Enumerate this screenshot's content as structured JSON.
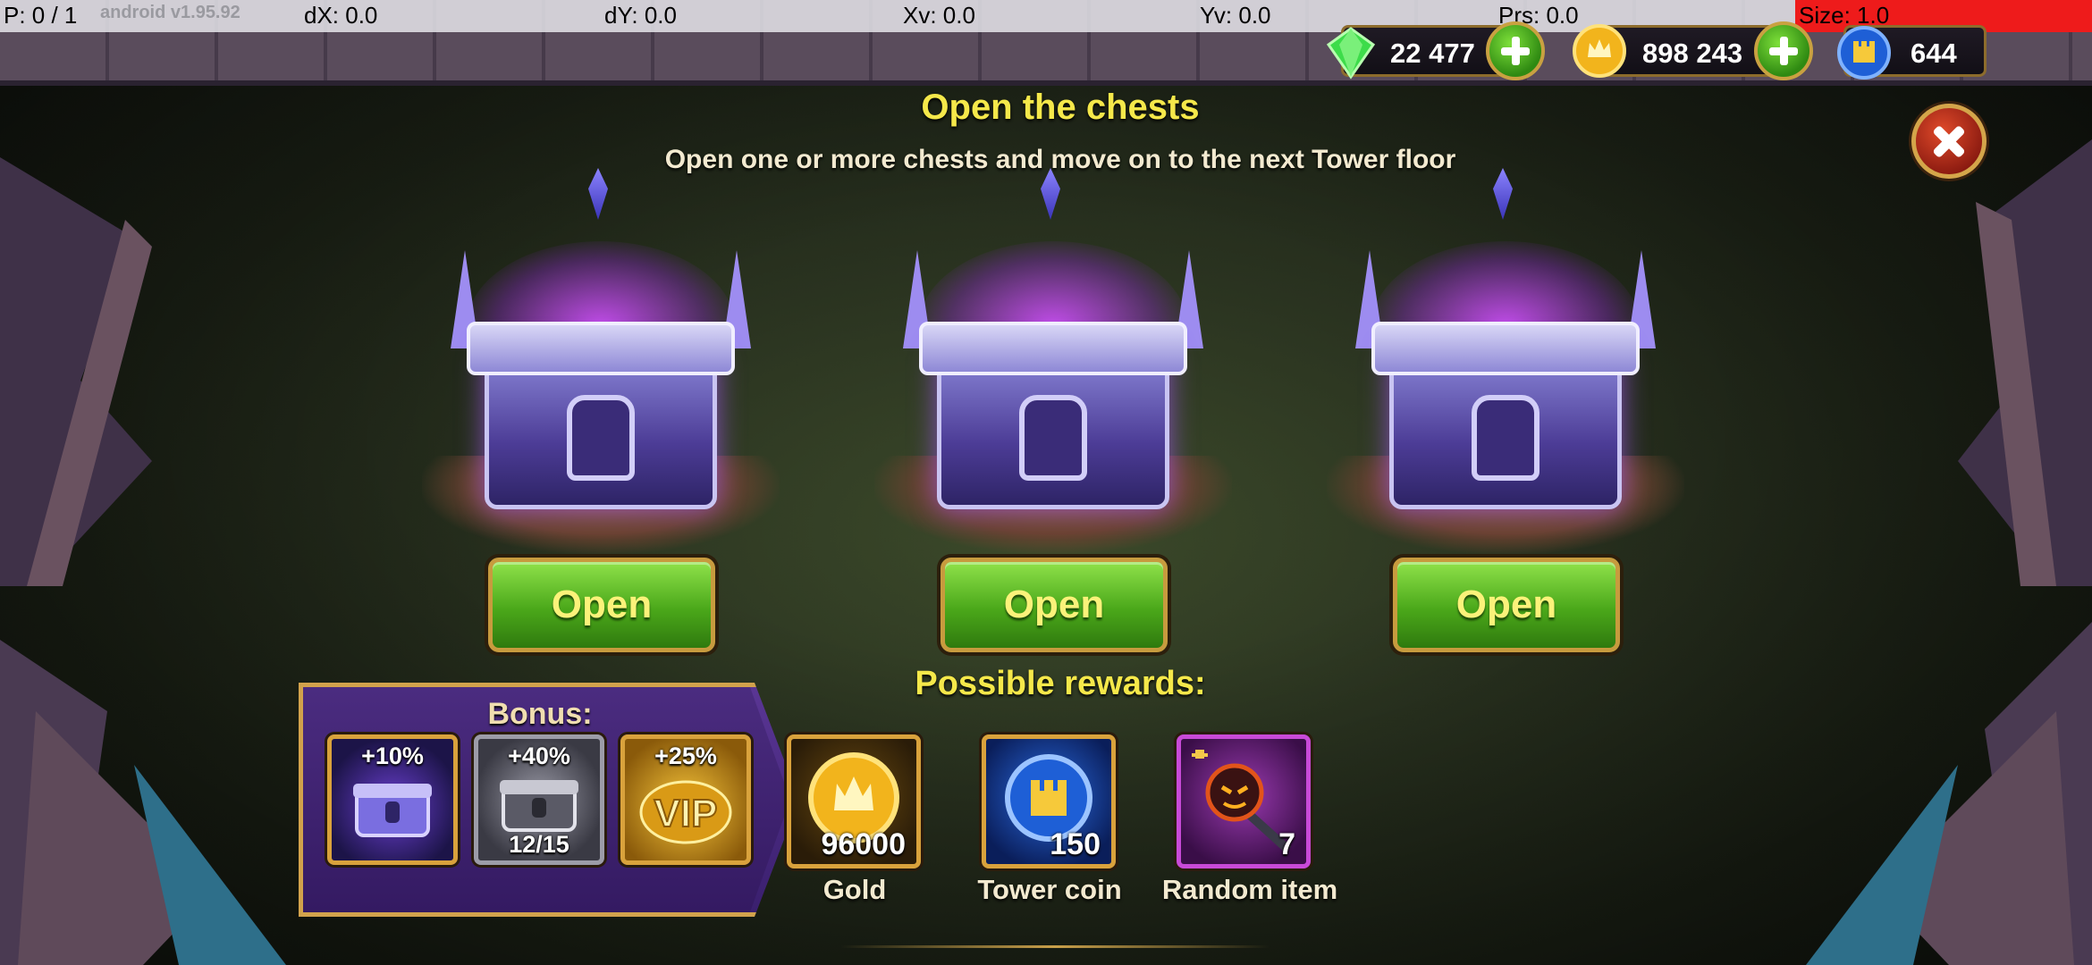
{
  "debug": {
    "p": "P: 0 / 1",
    "version": "android v1.95.92",
    "dx": "dX: 0.0",
    "dy": "dY: 0.0",
    "xv": "Xv: 0.0",
    "yv": "Yv: 0.0",
    "prs": "Prs: 0.0",
    "size": "Size: 1.0"
  },
  "currencies": {
    "emeralds": {
      "value": "22 477",
      "icon": "emerald-icon"
    },
    "gold": {
      "value": "898 243",
      "icon": "gold-coin-icon"
    },
    "tower_coins": {
      "value": "644",
      "icon": "tower-coin-icon"
    }
  },
  "dialog": {
    "title": "Open the chests",
    "subtitle": "Open one or more chests and move on to the next Tower floor"
  },
  "chests": [
    {
      "button": "Open"
    },
    {
      "button": "Open"
    },
    {
      "button": "Open"
    }
  ],
  "bonus": {
    "label": "Bonus:",
    "items": [
      {
        "percent": "+10%",
        "icon": "purple-chest-icon"
      },
      {
        "percent": "+40%",
        "count": "12/15",
        "icon": "silver-chest-icon"
      },
      {
        "percent": "+25%",
        "icon": "vip-icon"
      }
    ]
  },
  "rewards": {
    "title": "Possible rewards:",
    "items": [
      {
        "quantity": "96000",
        "label": "Gold",
        "icon": "gold-coin-icon"
      },
      {
        "quantity": "150",
        "label": "Tower coin",
        "icon": "tower-coin-icon"
      },
      {
        "quantity": "7",
        "label": "Random item",
        "icon": "staff-fragment-icon"
      }
    ]
  },
  "colors": {
    "title_yellow": "#f5e84a",
    "button_green": "#4ba81a",
    "frame_gold": "#d9a23c",
    "bonus_purple": "#4b2c80"
  }
}
